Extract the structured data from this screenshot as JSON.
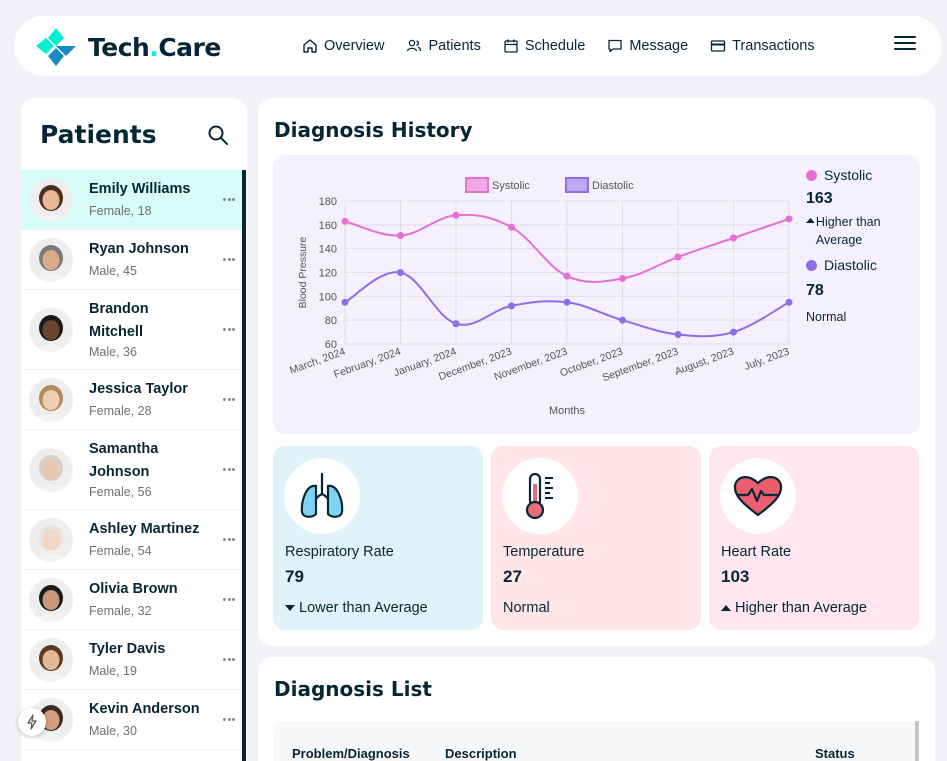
{
  "app": {
    "brand_main": "Tech",
    "brand_dot": ".",
    "brand_end": "Care"
  },
  "nav": [
    {
      "label": "Overview",
      "icon": "home-icon"
    },
    {
      "label": "Patients",
      "icon": "users-icon"
    },
    {
      "label": "Schedule",
      "icon": "calendar-icon"
    },
    {
      "label": "Message",
      "icon": "chat-icon"
    },
    {
      "label": "Transactions",
      "icon": "credit-card-icon"
    }
  ],
  "patients": {
    "title": "Patients",
    "list": [
      {
        "name": "Emily Williams",
        "meta": "Female, 18",
        "active": true
      },
      {
        "name": "Ryan Johnson",
        "meta": "Male, 45"
      },
      {
        "name": "Brandon Mitchell",
        "meta": "Male, 36"
      },
      {
        "name": "Jessica Taylor",
        "meta": "Female, 28"
      },
      {
        "name": "Samantha Johnson",
        "meta": "Female, 56"
      },
      {
        "name": "Ashley Martinez",
        "meta": "Female, 54"
      },
      {
        "name": "Olivia Brown",
        "meta": "Female, 32"
      },
      {
        "name": "Tyler Davis",
        "meta": "Male, 19"
      },
      {
        "name": "Kevin Anderson",
        "meta": "Male, 30"
      }
    ]
  },
  "history": {
    "title": "Diagnosis History",
    "systolic": {
      "label": "Systolic",
      "value": "163",
      "note": "Higher than Average",
      "color": "#e66fd2"
    },
    "diastolic": {
      "label": "Diastolic",
      "value": "78",
      "note": "Normal",
      "color": "#8c6fe6"
    }
  },
  "chart_data": {
    "type": "line",
    "categories": [
      "March, 2024",
      "February, 2024",
      "January, 2024",
      "December, 2023",
      "November, 2023",
      "October, 2023",
      "September, 2023",
      "August, 2023",
      "July, 2023"
    ],
    "series": [
      {
        "name": "Systolic",
        "values": [
          163,
          151,
          168,
          158,
          117,
          115,
          133,
          149,
          165
        ],
        "color": "#e66fd2"
      },
      {
        "name": "Diastolic",
        "values": [
          95,
          120,
          77,
          92,
          95,
          80,
          68,
          70,
          95
        ],
        "color": "#8c6fe6"
      }
    ],
    "xlabel": "Months",
    "ylabel": "Blood Pressure",
    "ylim": [
      60,
      180
    ],
    "yticks": [
      60,
      80,
      100,
      120,
      140,
      160,
      180
    ],
    "grid": true,
    "legend": "top"
  },
  "vitals": [
    {
      "label": "Respiratory Rate",
      "value": "79",
      "note": "Lower than Average",
      "arrow": "down",
      "bg": "#e0f3fa",
      "icon": "lungs-icon"
    },
    {
      "label": "Temperature",
      "value": "27",
      "note": "Normal",
      "arrow": "",
      "bg": "#ffe6e9",
      "icon": "thermometer-icon"
    },
    {
      "label": "Heart Rate",
      "value": "103",
      "note": "Higher than Average",
      "arrow": "up",
      "bg": "#ffe6f1",
      "icon": "heart-rate-icon"
    }
  ],
  "dlist": {
    "title": "Diagnosis List",
    "columns": [
      "Problem/Diagnosis",
      "Description",
      "Status"
    ]
  }
}
